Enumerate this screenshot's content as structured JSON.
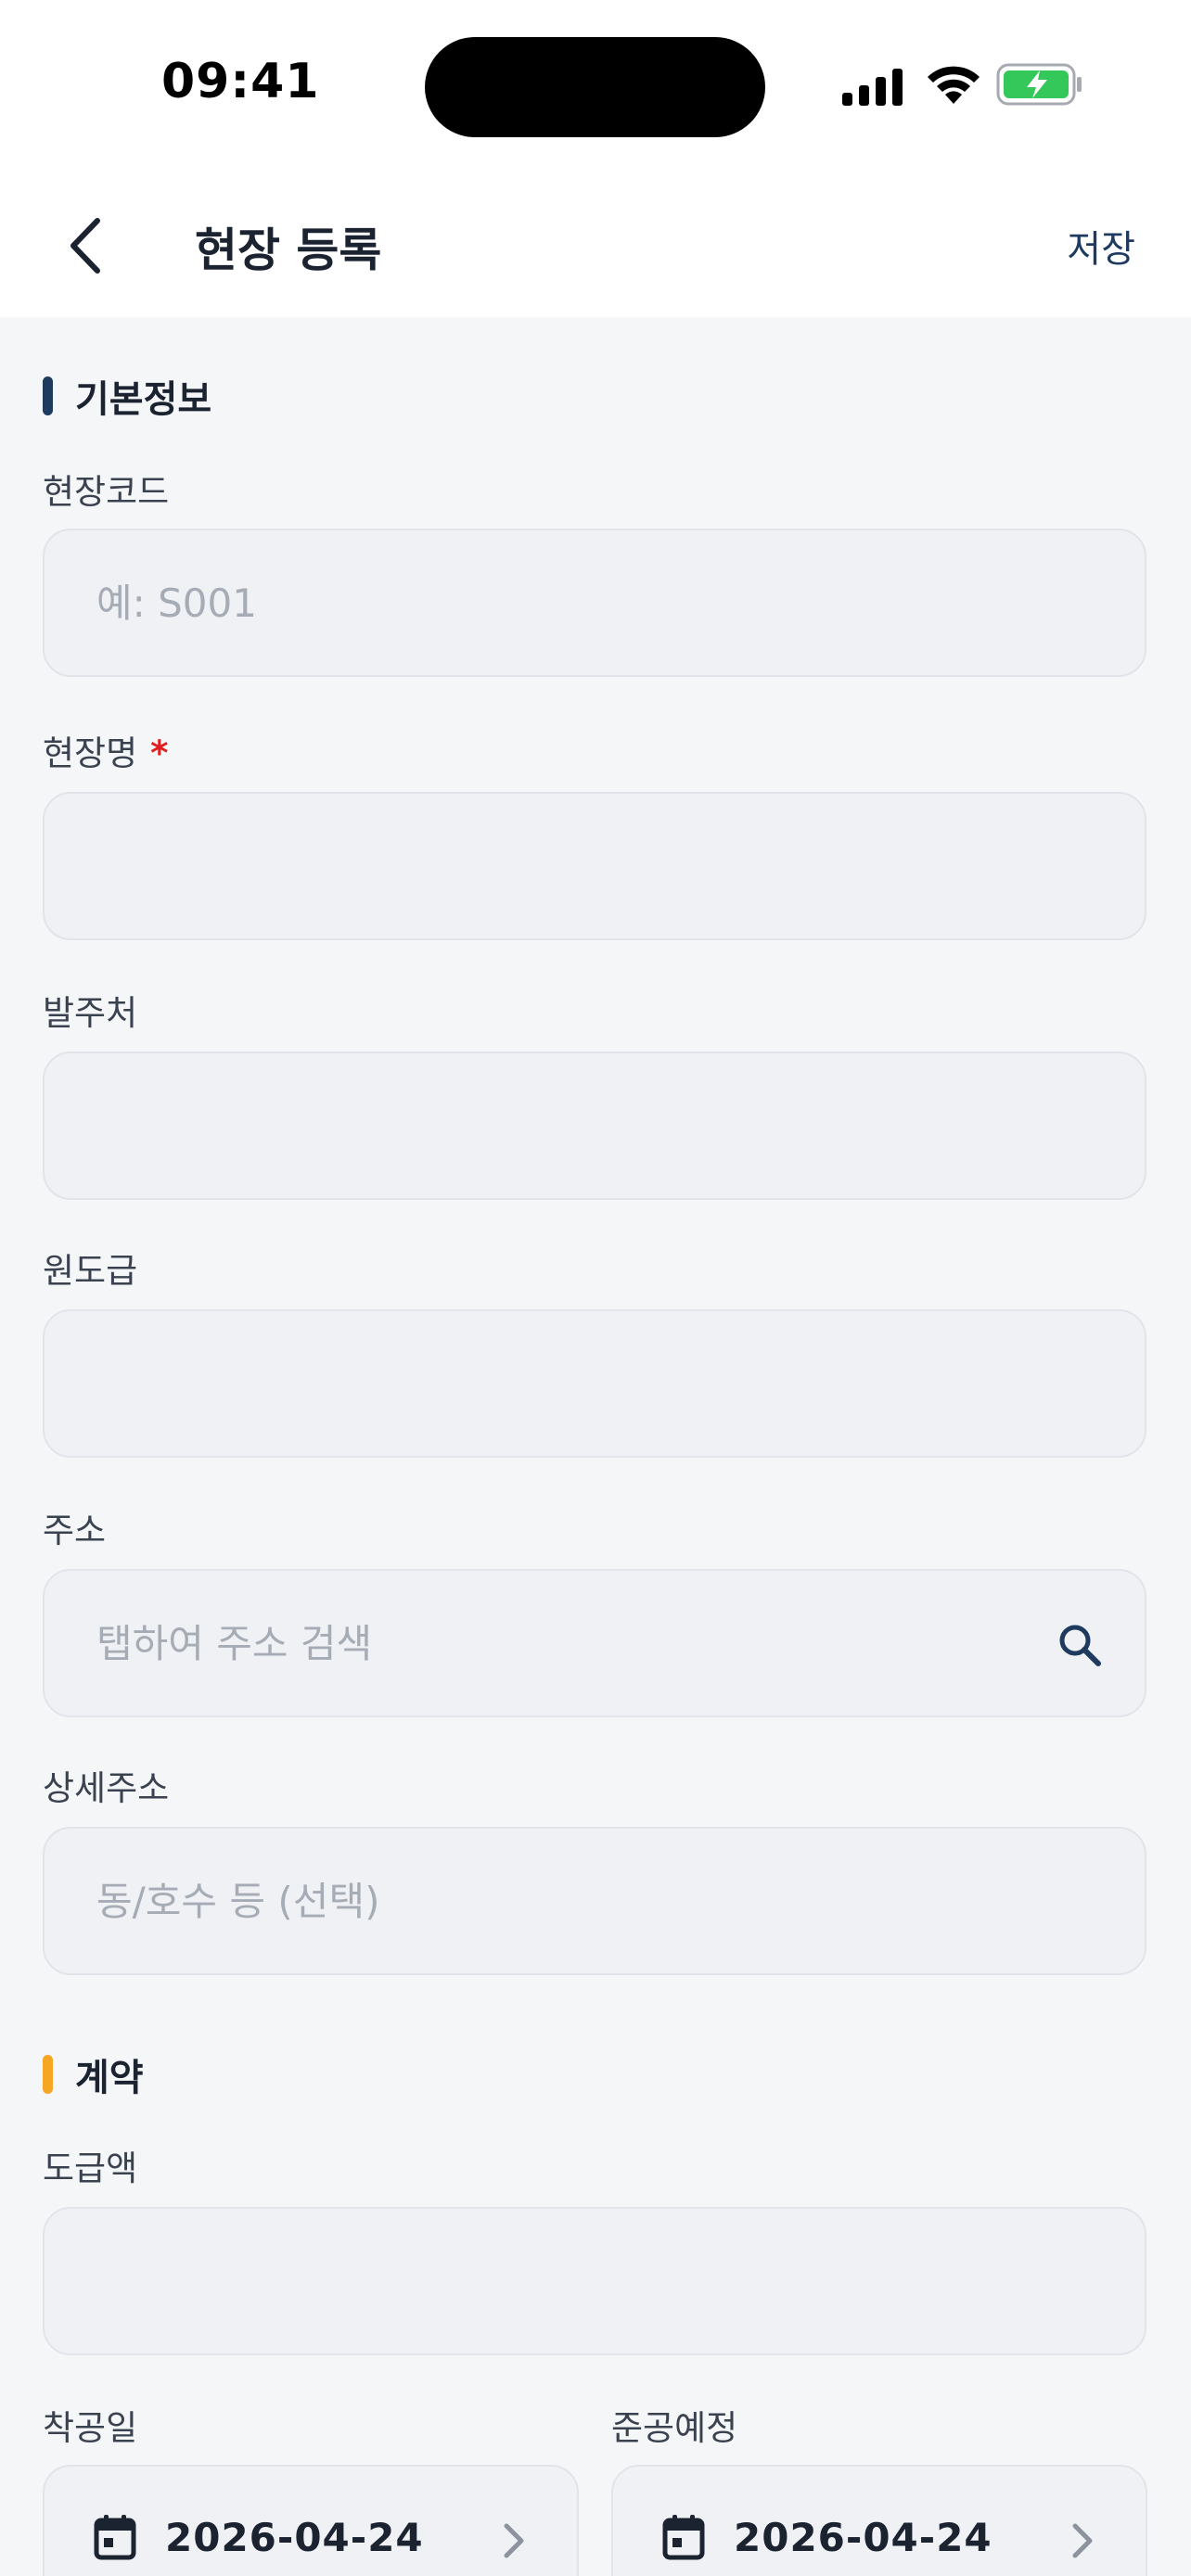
{
  "status_bar": {
    "time": "09:41"
  },
  "header": {
    "title": "현장 등록",
    "save_label": "저장"
  },
  "sections": {
    "basic": {
      "title": "기본정보",
      "accent": "#1f3a5f"
    },
    "contract": {
      "title": "계약",
      "accent": "#f5a623"
    }
  },
  "fields": {
    "site_code": {
      "label": "현장코드",
      "placeholder": "예: S001",
      "value": ""
    },
    "site_name": {
      "label": "현장명",
      "required_mark": "*",
      "placeholder": "",
      "value": ""
    },
    "client": {
      "label": "발주처",
      "placeholder": "",
      "value": ""
    },
    "prime_contractor": {
      "label": "원도급",
      "placeholder": "",
      "value": ""
    },
    "address": {
      "label": "주소",
      "placeholder": "탭하여 주소 검색",
      "value": "",
      "icon": "search-icon"
    },
    "address_detail": {
      "label": "상세주소",
      "placeholder": "동/호수 등 (선택)",
      "value": ""
    },
    "contract_amount": {
      "label": "도급액",
      "placeholder": "",
      "value": ""
    },
    "start_date": {
      "label": "착공일",
      "value": "2026-04-24",
      "icon": "calendar-icon"
    },
    "end_date": {
      "label": "준공예정",
      "value": "2026-04-24",
      "icon": "calendar-icon"
    }
  },
  "colors": {
    "primary": "#1e3a5f",
    "required": "#e02020",
    "battery": "#34c759"
  }
}
